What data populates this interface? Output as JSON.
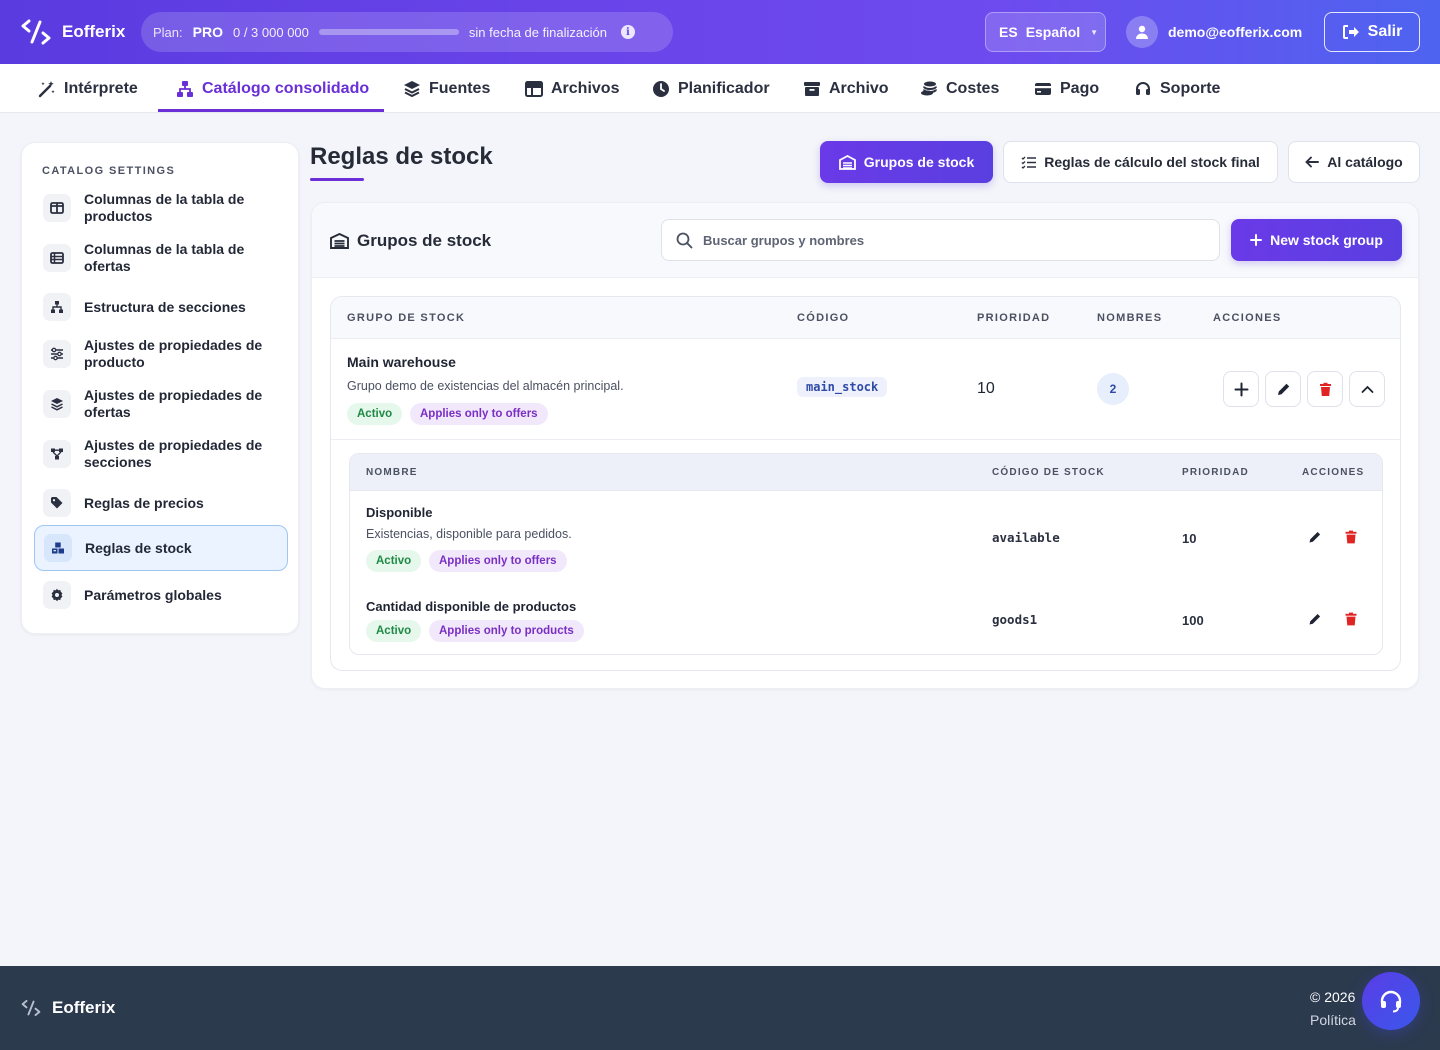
{
  "brand": {
    "name": "Eofferix"
  },
  "plan": {
    "label": "Plan:",
    "name": "PRO",
    "usage": "0 / 3 000 000",
    "used_fraction": 0,
    "end_text": "sin fecha de finalización"
  },
  "language": {
    "code": "ES",
    "name": "Español"
  },
  "user": {
    "email": "demo@eofferix.com"
  },
  "logout_label": "Salir",
  "nav": [
    {
      "label": "Intérprete",
      "icon": "magic-wand-icon"
    },
    {
      "label": "Catálogo consolidado",
      "icon": "sitemap-icon",
      "active": true
    },
    {
      "label": "Fuentes",
      "icon": "layers-icon"
    },
    {
      "label": "Archivos",
      "icon": "table-icon"
    },
    {
      "label": "Planificador",
      "icon": "clock-icon"
    },
    {
      "label": "Archivo",
      "icon": "archive-icon"
    },
    {
      "label": "Costes",
      "icon": "coins-icon"
    },
    {
      "label": "Pago",
      "icon": "credit-card-icon"
    },
    {
      "label": "Soporte",
      "icon": "headset-icon"
    }
  ],
  "sidebar": {
    "title": "CATALOG SETTINGS",
    "items": [
      {
        "label": "Columnas de la tabla de productos",
        "icon": "columns-icon"
      },
      {
        "label": "Columnas de la tabla de ofertas",
        "icon": "table-list-icon"
      },
      {
        "label": "Estructura de secciones",
        "icon": "sitemap-icon"
      },
      {
        "label": "Ajustes de propiedades de producto",
        "icon": "sliders-icon"
      },
      {
        "label": "Ajustes de propiedades de ofertas",
        "icon": "layers-icon"
      },
      {
        "label": "Ajustes de propiedades de secciones",
        "icon": "diagram-icon"
      },
      {
        "label": "Reglas de precios",
        "icon": "tags-icon"
      },
      {
        "label": "Reglas de stock",
        "icon": "cubes-icon",
        "active": true
      },
      {
        "label": "Parámetros globales",
        "icon": "gear-icon"
      }
    ]
  },
  "page": {
    "title": "Reglas de stock",
    "actions": {
      "groups": "Grupos de stock",
      "final_rules": "Reglas de cálculo del stock final",
      "back": "Al catálogo"
    }
  },
  "panel": {
    "title": "Grupos de stock",
    "search_placeholder": "Buscar grupos y nombres",
    "new_button": "New stock group",
    "columns": [
      "GRUPO DE STOCK",
      "CÓDIGO",
      "PRIORIDAD",
      "NOMBRES",
      "ACCIONES"
    ],
    "group": {
      "name": "Main warehouse",
      "description": "Grupo demo de existencias del almacén principal.",
      "status": "Activo",
      "scope": "Applies only to offers",
      "code": "main_stock",
      "priority": "10",
      "names_count": "2"
    },
    "sub_columns": [
      "NOMBRE",
      "CÓDIGO DE STOCK",
      "PRIORIDAD",
      "ACCIONES"
    ],
    "sub_rows": [
      {
        "name": "Disponible",
        "description": "Existencias, disponible para pedidos.",
        "status": "Activo",
        "scope": "Applies only to offers",
        "code": "available",
        "priority": "10"
      },
      {
        "name": "Cantidad disponible de productos",
        "description": "",
        "status": "Activo",
        "scope": "Applies only to products",
        "code": "goods1",
        "priority": "100"
      }
    ]
  },
  "footer": {
    "brand": "Eofferix",
    "copyright": "© 2026",
    "policy": "Política"
  },
  "colors": {
    "accent": "#6a2fd6",
    "primary_gradient_start": "#5a3be0",
    "danger": "#e02424",
    "footer_bg": "#2c3a4e"
  }
}
